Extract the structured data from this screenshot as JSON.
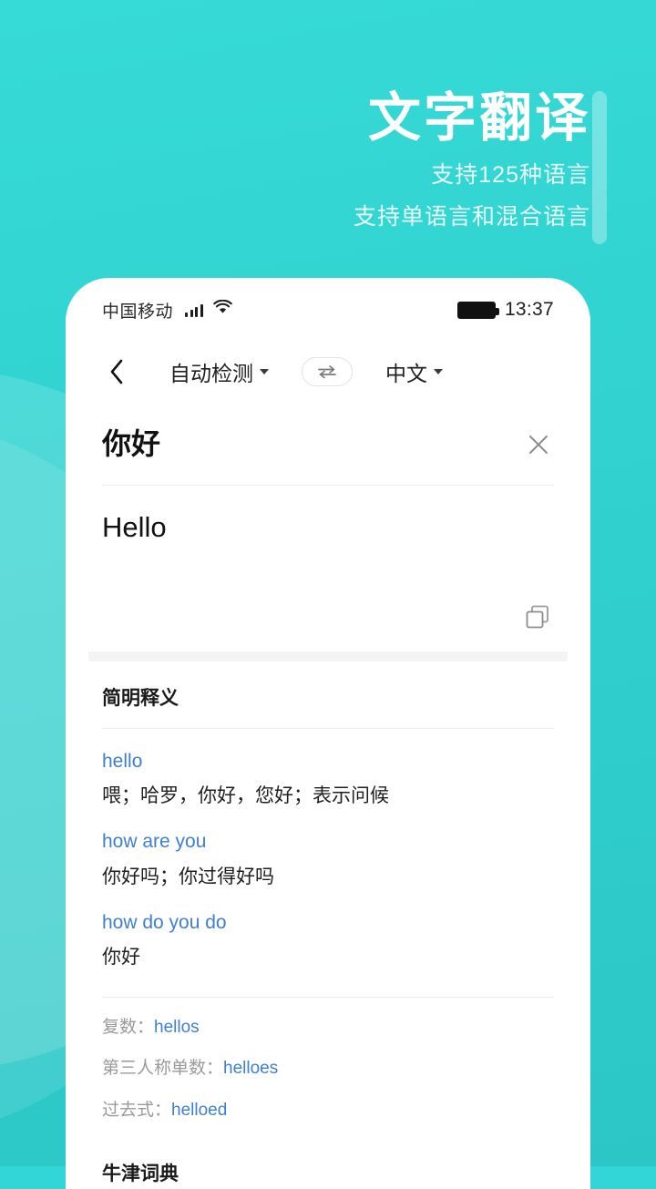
{
  "hero": {
    "title": "文字翻译",
    "subtitle_1": "支持125种语言",
    "subtitle_2": "支持单语言和混合语言"
  },
  "colors": {
    "background_top": "#36dad6",
    "background_bottom": "#2cc6c6",
    "link_blue": "#3f7fd1",
    "muted_gray": "#9a9a9a",
    "band_gray": "#f2f4f6"
  },
  "phone": {
    "status_bar": {
      "carrier": "中国移动",
      "signal_icon": "signal-bars-icon",
      "wifi_icon": "wifi-icon",
      "battery_icon": "battery-full-icon",
      "clock": "13:37"
    },
    "nav_bar": {
      "back_icon": "chevron-left-icon",
      "source_language": "自动检测",
      "swap_icon": "swap-arrows-icon",
      "target_language": "中文"
    },
    "translate": {
      "source_text": "你好",
      "clear_icon": "close-icon",
      "target_text": "Hello",
      "copy_icon": "copy-icon"
    },
    "dictionary": {
      "title": "简明释义",
      "entries": [
        {
          "term": "hello",
          "definition": "喂；哈罗，你好，您好；表示问候"
        },
        {
          "term": "how are you",
          "definition": "你好吗；你过得好吗"
        },
        {
          "term": "how do you do",
          "definition": "你好"
        }
      ],
      "word_forms": [
        {
          "label": "复数：",
          "value": "hellos"
        },
        {
          "label": "第三人称单数：",
          "value": "helloes"
        },
        {
          "label": "过去式：",
          "value": "helloed"
        }
      ],
      "oxford_title": "牛津词典"
    }
  }
}
